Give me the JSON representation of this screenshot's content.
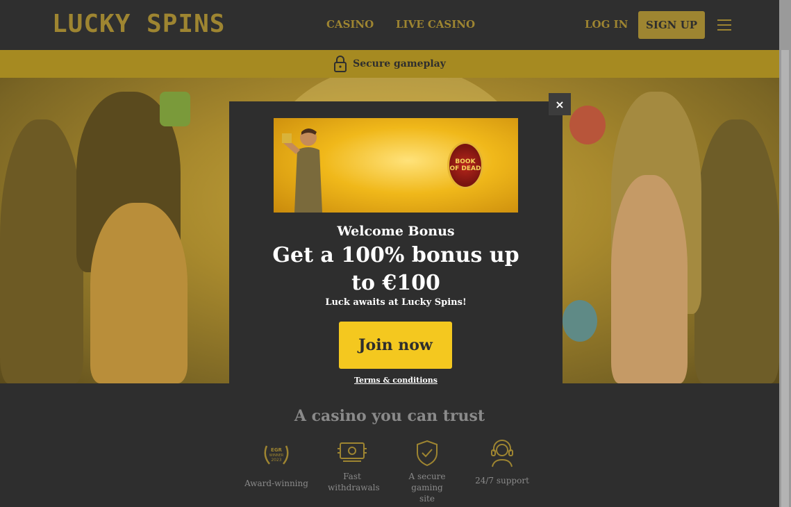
{
  "header": {
    "logo": "LUCKY SPINS",
    "nav": [
      "CASINO",
      "LIVE CASINO"
    ],
    "login": "LOG IN",
    "signup": "SIGN UP"
  },
  "secure": {
    "label": "Secure gameplay",
    "icon": "padlock-icon"
  },
  "modal": {
    "close": "×",
    "banner_badge": "BOOK OF DEAD",
    "eyebrow": "Welcome Bonus",
    "headline_line1": "Get a 100% bonus up",
    "headline_line2": "to €100",
    "subtext": "Luck awaits at Lucky Spins!",
    "cta": "Join now",
    "terms": "Terms & conditions"
  },
  "trust": {
    "title": "A casino you can trust",
    "items": [
      {
        "label": "Award-winning",
        "icon": "egr-award-icon",
        "badge": [
          "EGR",
          "WINNER",
          "2023"
        ]
      },
      {
        "label": "Fast withdrawals",
        "icon": "money-icon"
      },
      {
        "label": "A secure gaming site",
        "icon": "shield-check-icon"
      },
      {
        "label": "24/7 support",
        "icon": "headset-icon"
      }
    ]
  },
  "colors": {
    "brand_gold": "#9e8531",
    "cta_yellow": "#f4c81f",
    "background": "#2e2e2e"
  }
}
